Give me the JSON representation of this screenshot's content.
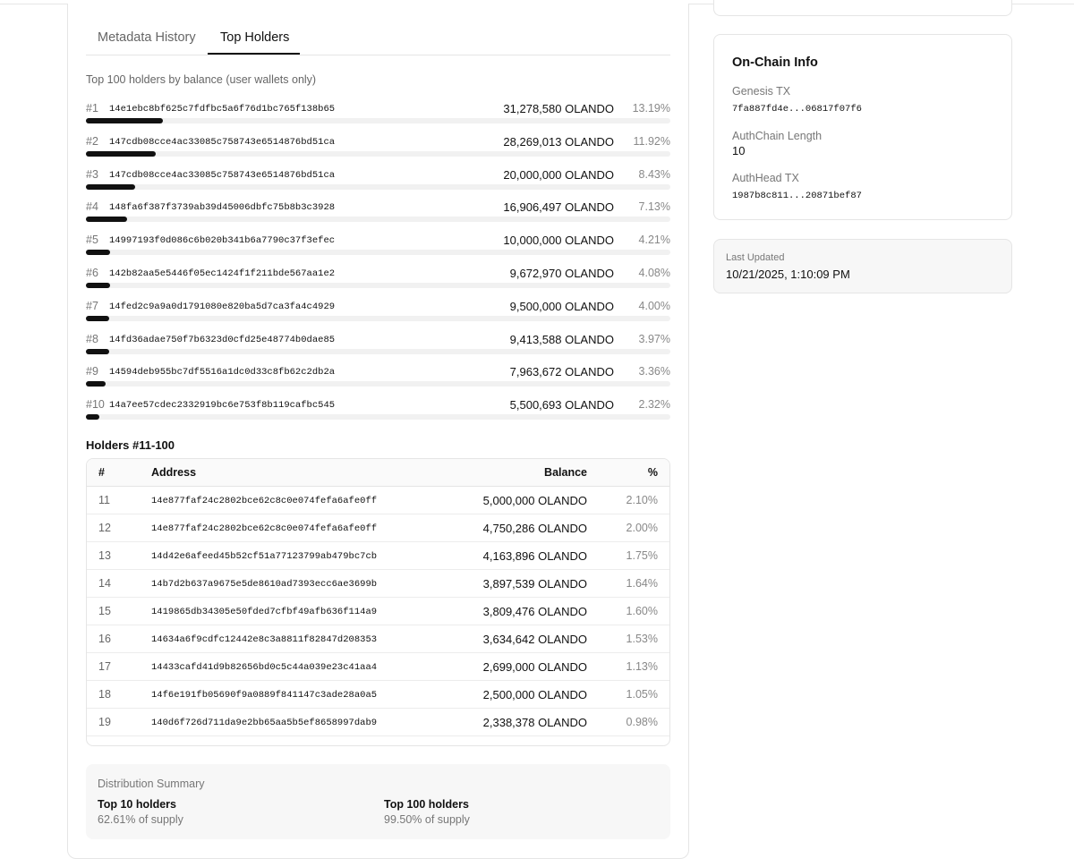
{
  "tabs": [
    {
      "label": "Metadata History",
      "active": false
    },
    {
      "label": "Top Holders",
      "active": true
    }
  ],
  "subtitle": "Top 100 holders by balance (user wallets only)",
  "top_holders": [
    {
      "rank": "#1",
      "address": "14e1ebc8bf625c7fdfbc5a6f76d1bc765f138b65",
      "balance": "31,278,580 OLANDO",
      "percent": "13.19%",
      "share": 13.19
    },
    {
      "rank": "#2",
      "address": "147cdb08cce4ac33085c758743e6514876bd51ca",
      "balance": "28,269,013 OLANDO",
      "percent": "11.92%",
      "share": 11.92
    },
    {
      "rank": "#3",
      "address": "147cdb08cce4ac33085c758743e6514876bd51ca",
      "balance": "20,000,000 OLANDO",
      "percent": "8.43%",
      "share": 8.43
    },
    {
      "rank": "#4",
      "address": "148fa6f387f3739ab39d45006dbfc75b8b3c3928",
      "balance": "16,906,497 OLANDO",
      "percent": "7.13%",
      "share": 7.13
    },
    {
      "rank": "#5",
      "address": "14997193f0d086c6b020b341b6a7790c37f3efec",
      "balance": "10,000,000 OLANDO",
      "percent": "4.21%",
      "share": 4.21
    },
    {
      "rank": "#6",
      "address": "142b82aa5e5446f05ec1424f1f211bde567aa1e2",
      "balance": "9,672,970 OLANDO",
      "percent": "4.08%",
      "share": 4.08
    },
    {
      "rank": "#7",
      "address": "14fed2c9a9a0d1791080e820ba5d7ca3fa4c4929",
      "balance": "9,500,000 OLANDO",
      "percent": "4.00%",
      "share": 4.0
    },
    {
      "rank": "#8",
      "address": "14fd36adae750f7b6323d0cfd25e48774b0dae85",
      "balance": "9,413,588 OLANDO",
      "percent": "3.97%",
      "share": 3.97
    },
    {
      "rank": "#9",
      "address": "14594deb955bc7df5516a1dc0d33c8fb62c2db2a",
      "balance": "7,963,672 OLANDO",
      "percent": "3.36%",
      "share": 3.36
    },
    {
      "rank": "#10",
      "address": "14a7ee57cdec2332919bc6e753f8b119cafbc545",
      "balance": "5,500,693 OLANDO",
      "percent": "2.32%",
      "share": 2.32
    }
  ],
  "holders_table": {
    "title": "Holders #11-100",
    "columns": {
      "num": "#",
      "address": "Address",
      "balance": "Balance",
      "percent": "%"
    },
    "rows": [
      {
        "num": "11",
        "address": "14e877faf24c2802bce62c8c0e074fefa6afe0ff",
        "balance": "5,000,000 OLANDO",
        "percent": "2.10%"
      },
      {
        "num": "12",
        "address": "14e877faf24c2802bce62c8c0e074fefa6afe0ff",
        "balance": "4,750,286 OLANDO",
        "percent": "2.00%"
      },
      {
        "num": "13",
        "address": "14d42e6afeed45b52cf51a77123799ab479bc7cb",
        "balance": "4,163,896 OLANDO",
        "percent": "1.75%"
      },
      {
        "num": "14",
        "address": "14b7d2b637a9675e5de8610ad7393ecc6ae3699b",
        "balance": "3,897,539 OLANDO",
        "percent": "1.64%"
      },
      {
        "num": "15",
        "address": "1419865db34305e50fded7cfbf49afb636f114a9",
        "balance": "3,809,476 OLANDO",
        "percent": "1.60%"
      },
      {
        "num": "16",
        "address": "14634a6f9cdfc12442e8c3a8811f82847d208353",
        "balance": "3,634,642 OLANDO",
        "percent": "1.53%"
      },
      {
        "num": "17",
        "address": "14433cafd41d9b82656bd0c5c44a039e23c41aa4",
        "balance": "2,699,000 OLANDO",
        "percent": "1.13%"
      },
      {
        "num": "18",
        "address": "14f6e191fb05690f9a0889f841147c3ade28a0a5",
        "balance": "2,500,000 OLANDO",
        "percent": "1.05%"
      },
      {
        "num": "19",
        "address": "140d6f726d711da9e2bb65aa5b5ef8658997dab9",
        "balance": "2,338,378 OLANDO",
        "percent": "0.98%"
      }
    ]
  },
  "distribution": {
    "title": "Distribution Summary",
    "top10_label": "Top 10 holders",
    "top10_value": "62.61% of supply",
    "top100_label": "Top 100 holders",
    "top100_value": "99.50% of supply"
  },
  "onchain": {
    "title": "On-Chain Info",
    "genesis_label": "Genesis TX",
    "genesis_value": "7fa887fd4e...06817f07f6",
    "authchain_label": "AuthChain Length",
    "authchain_value": "10",
    "authhead_label": "AuthHead TX",
    "authhead_value": "1987b8c811...20871bef87"
  },
  "last_updated": {
    "label": "Last Updated",
    "value": "10/21/2025, 1:10:09 PM"
  }
}
